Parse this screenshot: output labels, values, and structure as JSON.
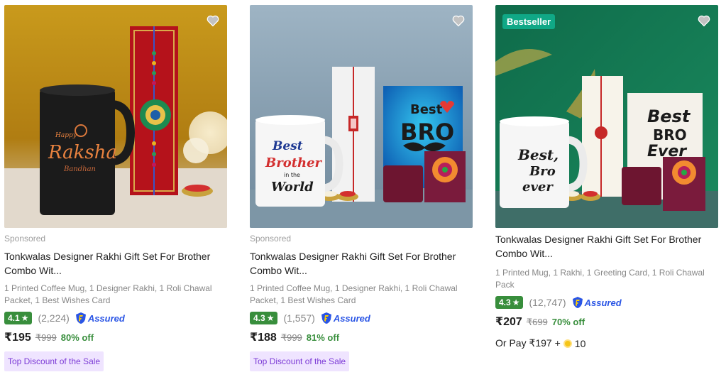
{
  "products": [
    {
      "sponsored": "Sponsored",
      "title": "Tonkwalas Designer Rakhi Gift Set For Brother Combo Wit...",
      "description": "1 Printed Coffee Mug, 1 Designer Rakhi, 1 Roli Chawal Packet, 1 Best Wishes Card",
      "rating": "4.1",
      "rating_count": "(2,224)",
      "assured_label": "Assured",
      "price": "₹195",
      "mrp": "₹999",
      "discount": "80% off",
      "tag": "Top Discount of the Sale",
      "mug_text_top": "Happy",
      "mug_text_main": "Raksha",
      "mug_text_bottom": "Bandhan"
    },
    {
      "sponsored": "Sponsored",
      "title": "Tonkwalas Designer Rakhi Gift Set For Brother Combo Wit...",
      "description": "1 Printed Coffee Mug, 1 Designer Rakhi, 1 Roli Chawal Packet, 1 Best Wishes Card",
      "rating": "4.3",
      "rating_count": "(1,557)",
      "assured_label": "Assured",
      "price": "₹188",
      "mrp": "₹999",
      "discount": "81% off",
      "tag": "Top Discount of the Sale",
      "mug_text_1": "Best",
      "mug_text_2": "Brother",
      "mug_text_3": "in the",
      "mug_text_4": "World",
      "card_text_1": "Best",
      "card_text_2": "BRO"
    },
    {
      "badge": "Bestseller",
      "title": "Tonkwalas Designer Rakhi Gift Set For Brother Combo Wit...",
      "description": "1 Printed Mug, 1 Rakhi, 1 Greeting Card, 1 Roli Chawal Pack",
      "rating": "4.3",
      "rating_count": "(12,747)",
      "assured_label": "Assured",
      "price": "₹207",
      "mrp": "₹699",
      "discount": "70% off",
      "or_pay": "Or Pay ₹197 +",
      "coins": "10",
      "mug_text_1": "Best,",
      "mug_text_2": "Bro",
      "mug_text_3": "ever",
      "card_text_1": "Best",
      "card_text_2": "BRO",
      "card_text_3": "Ever"
    }
  ],
  "colors": {
    "rating_green": "#388e3c",
    "assured_blue": "#2a55e5",
    "bestseller_badge": "#10a886",
    "tag_bg": "#efe4ff",
    "tag_text": "#7c3bd6"
  }
}
